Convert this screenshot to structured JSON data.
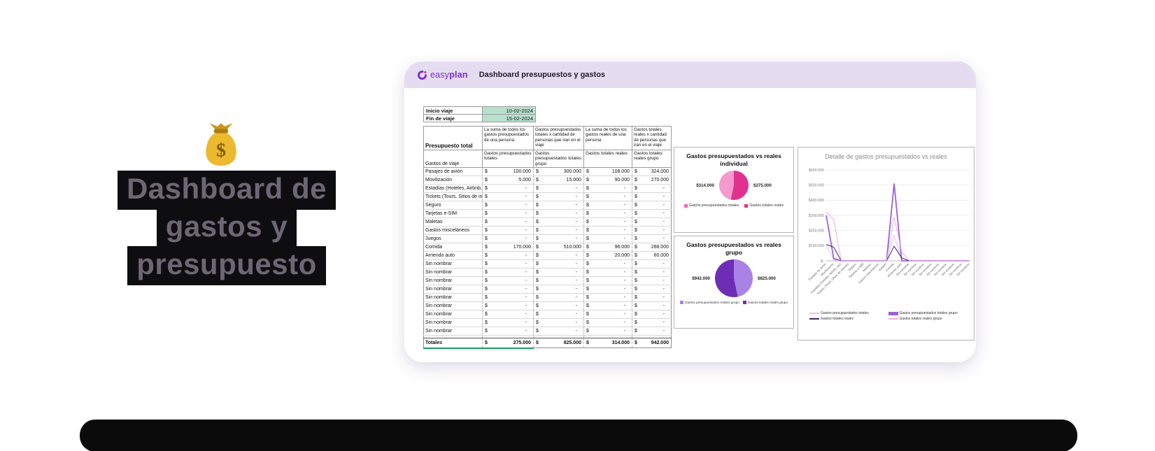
{
  "slide": {
    "title_lines": [
      "Dashboard de",
      "gastos y",
      "presupuesto"
    ],
    "emoji": "money-bag"
  },
  "app": {
    "logo_easy": "easy",
    "logo_plan": "plan",
    "header_title": "Dashboard presupuestos y gastos"
  },
  "colors": {
    "header_bar": "#e6dcf2",
    "logo_purple": "#7a2dcb",
    "date_highlight": "#b7e1cd",
    "totals_accent": "#17a05d"
  },
  "trip_dates": {
    "rows": [
      {
        "label": "Inicio viaje",
        "value": "10-02-2024"
      },
      {
        "label": "Fin de viaje",
        "value": "15-02-2024"
      }
    ]
  },
  "table": {
    "corner_title": "Presupuesto total",
    "row_header": "Gastos de viaje",
    "currency": "$",
    "col_groups": [
      "La suma de todos los gastos presupuestados de una persona",
      "Gastos presupuestados totales x cantidad de personas que iran en el viaje",
      "La suma de todos los gastos reales de una persona",
      "Gastos totales reales x cantidad de personas que iran en el viaje"
    ],
    "columns": [
      "Gastos presupuestados totales",
      "Gastos presupuestados totales grupo",
      "Gastos totales reales",
      "Gastos totales reales grupo"
    ],
    "rows": [
      {
        "label": "Pasajes de avión",
        "values": [
          "100.000",
          "300.000",
          "108.000",
          "324.000"
        ]
      },
      {
        "label": "Movilización",
        "values": [
          "5.000",
          "15.000",
          "90.000",
          "270.000"
        ]
      },
      {
        "label": "Estadías (Hoteles, Airbnb, etc)",
        "values": [
          "-",
          "-",
          "-",
          "-"
        ]
      },
      {
        "label": "Tickets (Tours, Sitios de interés)",
        "values": [
          "-",
          "-",
          "-",
          "-"
        ]
      },
      {
        "label": "Seguro",
        "values": [
          "-",
          "-",
          "-",
          "-"
        ]
      },
      {
        "label": "Tarjetas e-SIM",
        "values": [
          "-",
          "-",
          "-",
          "-"
        ]
      },
      {
        "label": "Maletas",
        "values": [
          "-",
          "-",
          "-",
          "-"
        ]
      },
      {
        "label": "Gastos misceláneos",
        "values": [
          "-",
          "-",
          "-",
          "-"
        ]
      },
      {
        "label": "Juegos",
        "values": [
          "-",
          "-",
          "-",
          "-"
        ]
      },
      {
        "label": "Comida",
        "values": [
          "170.000",
          "510.000",
          "96.000",
          "288.000"
        ]
      },
      {
        "label": "Arriendo auto",
        "values": [
          "-",
          "-",
          "20.000",
          "60.000"
        ]
      },
      {
        "label": "Sin nombrar",
        "values": [
          "-",
          "-",
          "-",
          "-"
        ]
      },
      {
        "label": "Sin nombrar",
        "values": [
          "-",
          "-",
          "-",
          "-"
        ]
      },
      {
        "label": "Sin nombrar",
        "values": [
          "-",
          "-",
          "-",
          "-"
        ]
      },
      {
        "label": "Sin nombrar",
        "values": [
          "-",
          "-",
          "-",
          "-"
        ]
      },
      {
        "label": "Sin nombrar",
        "values": [
          "-",
          "-",
          "-",
          "-"
        ]
      },
      {
        "label": "Sin nombrar",
        "values": [
          "-",
          "-",
          "-",
          "-"
        ]
      },
      {
        "label": "Sin nombrar",
        "values": [
          "-",
          "-",
          "-",
          "-"
        ]
      },
      {
        "label": "Sin nombrar",
        "values": [
          "-",
          "-",
          "-",
          "-"
        ]
      },
      {
        "label": "Sin nombrar",
        "values": [
          "-",
          "-",
          "-",
          "-"
        ]
      }
    ],
    "totals": {
      "label": "Totales",
      "values": [
        "275.000",
        "825.000",
        "314.000",
        "942.000"
      ]
    }
  },
  "chart_data": [
    {
      "type": "pie",
      "title": "Gastos presupuestados vs reales",
      "subtitle": "individual",
      "label_left": "$314.000",
      "label_right": "$275.000",
      "slices": [
        {
          "name": "Gastos totales reales",
          "value": 314000,
          "color": "#e0318f"
        },
        {
          "name": "Gastos presupuestados totales",
          "value": 275000,
          "color": "#f49ace"
        }
      ],
      "legend": [
        {
          "label": "Gastos presupuestados totales",
          "color": "#f063b8"
        },
        {
          "label": "Gastos totales reales",
          "color": "#e0318f"
        }
      ]
    },
    {
      "type": "pie",
      "title": "Gastos presupuestados vs reales",
      "subtitle": "grupo",
      "label_left": "$942.000",
      "label_right": "$825.000",
      "slices": [
        {
          "name": "Gastos presupuestados totales grupo",
          "value": 825000,
          "color": "#a982e6"
        },
        {
          "name": "Gastos totales reales grupo",
          "value": 942000,
          "color": "#6d2eb5"
        }
      ],
      "legend": [
        {
          "label": "Gastos presupuestados totales grupo",
          "color": "#a982e6"
        },
        {
          "label": "Gastos totales reales grupo",
          "color": "#6d2eb5"
        }
      ]
    },
    {
      "type": "line",
      "title": "Detalle de gastos presupuestados vs reales",
      "ylim": [
        0,
        600000
      ],
      "ytick_labels": [
        "$-",
        "$100.000",
        "$200.000",
        "$300.000",
        "$400.000",
        "$500.000",
        "$600.000"
      ],
      "legend_position": "bottom",
      "grid": true,
      "categories": [
        "Pasajes de avión",
        "Movilización",
        "Estadías (Hoteles, Airbnb, etc)",
        "Tickets (Tours, Sitios de interés)",
        "Seguro",
        "Tarjetas e-SIM",
        "Maletas",
        "Gastos misceláneos",
        "Juegos",
        "Comida",
        "Arriendo auto",
        "Sin nombrar",
        "Sin nombrar",
        "Sin nombrar",
        "Sin nombrar",
        "Sin nombrar",
        "Sin nombrar",
        "Sin nombrar",
        "Sin nombrar",
        "Sin nombrar"
      ],
      "series": [
        {
          "name": "Gastos presupuestados totales",
          "color": "#dcc8f5",
          "stroke_width": 1,
          "values": [
            100000,
            5000,
            0,
            0,
            0,
            0,
            0,
            0,
            0,
            170000,
            0,
            0,
            0,
            0,
            0,
            0,
            0,
            0,
            0,
            0
          ]
        },
        {
          "name": "Gastos presupuestados totales grupo",
          "color": "#9a63d8",
          "stroke_width": 1.8,
          "values": [
            300000,
            15000,
            0,
            0,
            0,
            0,
            0,
            0,
            0,
            510000,
            0,
            0,
            0,
            0,
            0,
            0,
            0,
            0,
            0,
            0
          ]
        },
        {
          "name": "Gastos totales reales",
          "color": "#3f2566",
          "stroke_width": 1,
          "values": [
            108000,
            90000,
            0,
            0,
            0,
            0,
            0,
            0,
            0,
            96000,
            20000,
            0,
            0,
            0,
            0,
            0,
            0,
            0,
            0,
            0
          ]
        },
        {
          "name": "Gastos totales reales grupo",
          "color": "#efaede",
          "stroke_width": 1,
          "values": [
            324000,
            270000,
            0,
            0,
            0,
            0,
            0,
            0,
            0,
            288000,
            60000,
            0,
            0,
            0,
            0,
            0,
            0,
            0,
            0,
            0
          ]
        }
      ]
    }
  ]
}
